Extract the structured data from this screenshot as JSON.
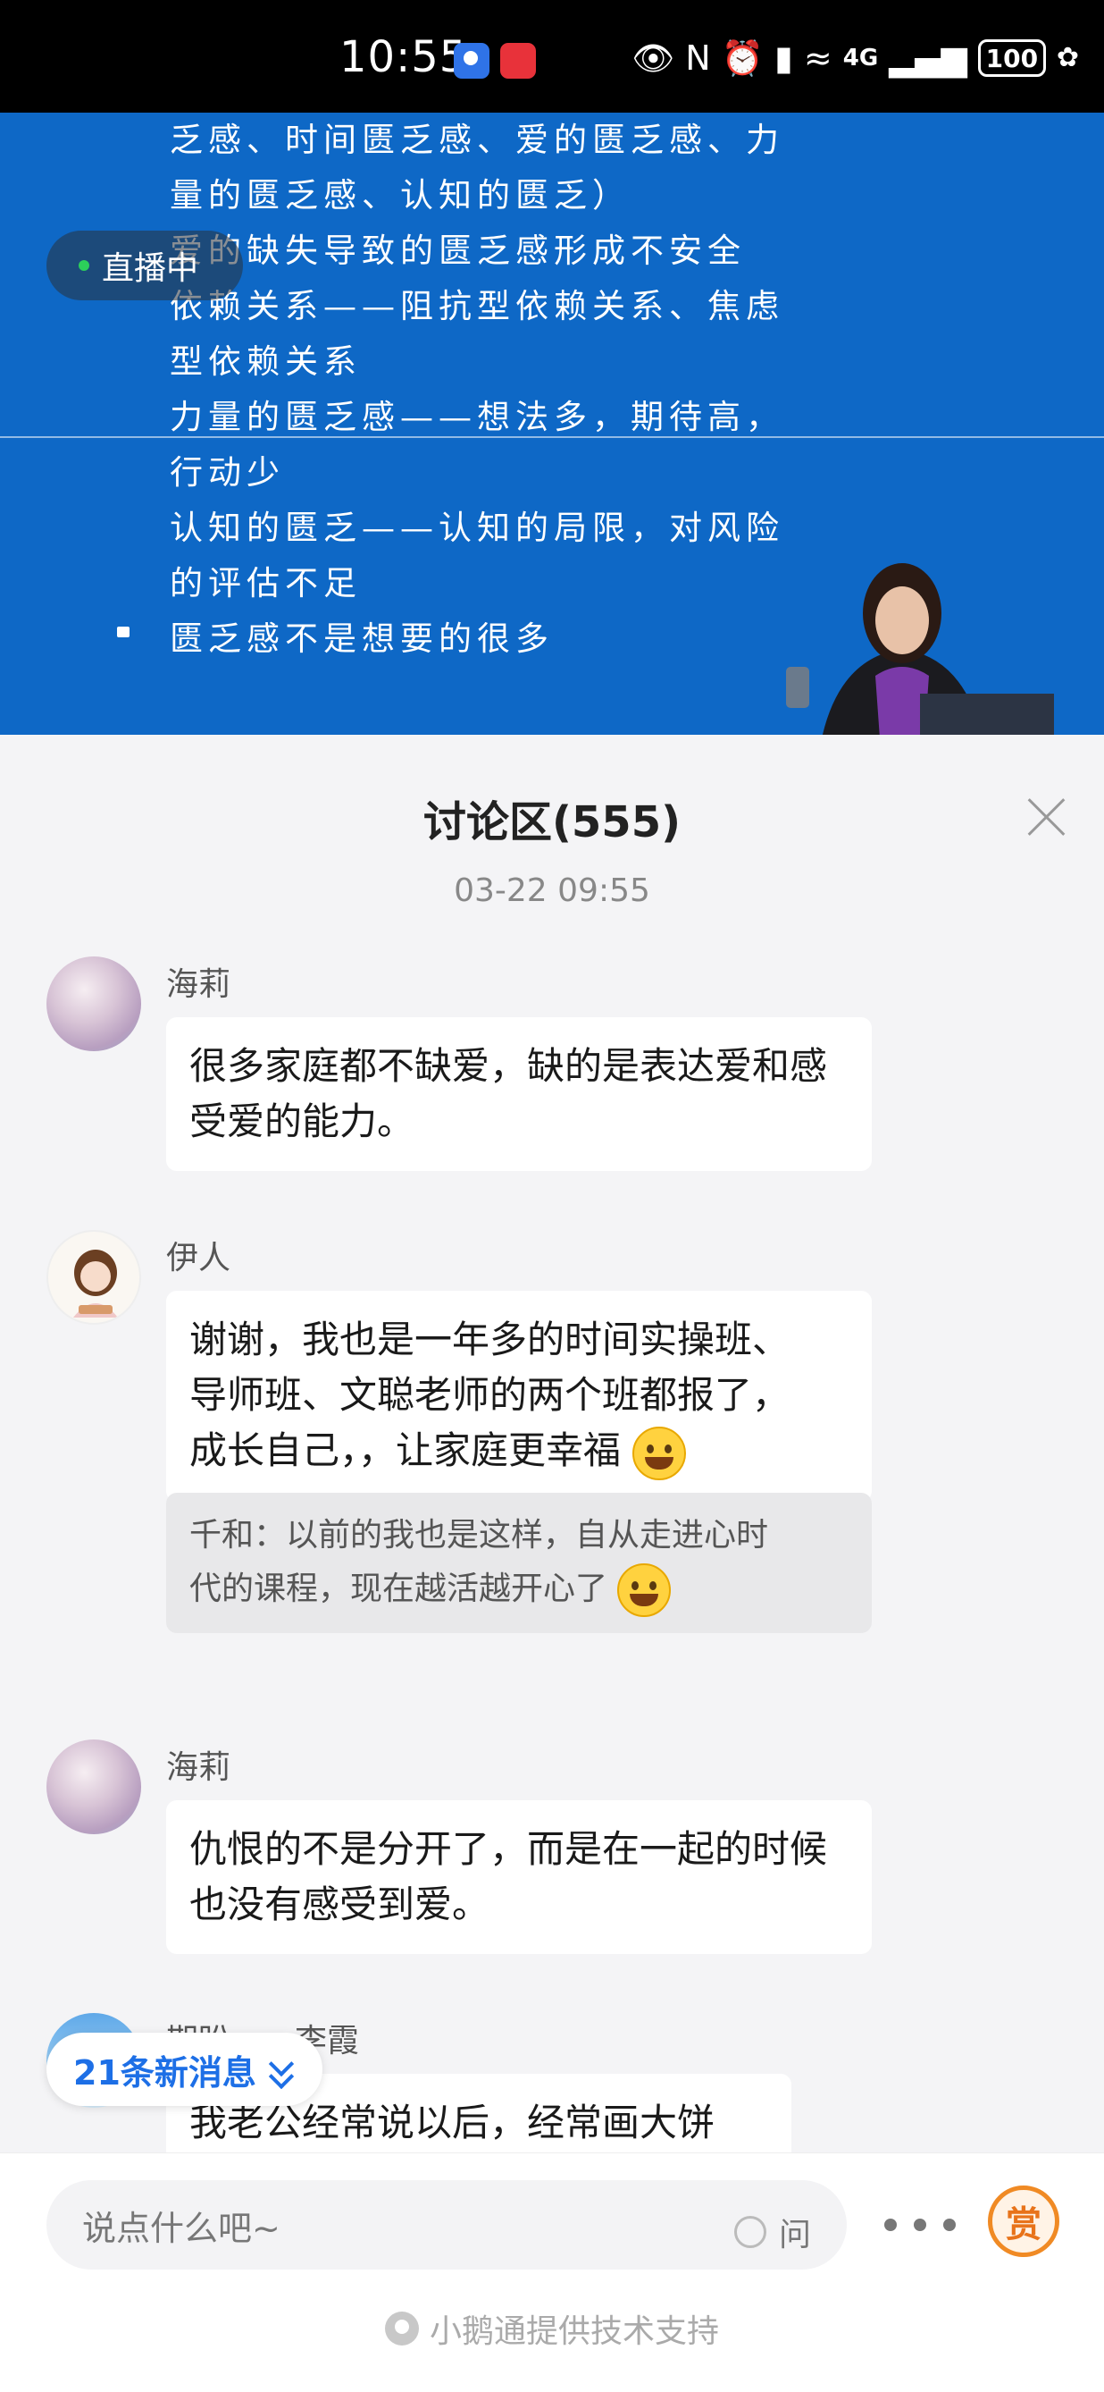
{
  "status_bar": {
    "time": "10:55",
    "battery": "100",
    "network": "4G"
  },
  "video": {
    "live_label": "直播中",
    "slide_lines": [
      "乏感、时间匮乏感、爱的匮乏感、力",
      "量的匮乏感、认知的匮乏）",
      "爱的缺失导致的匮乏感形成不安全",
      "依赖关系——阻抗型依赖关系、焦虑",
      "型依赖关系",
      "力量的匮乏感——想法多，期待高，",
      "行动少",
      "认知的匮乏——认知的局限，对风险",
      "的评估不足",
      "匮乏感不是想要的很多"
    ]
  },
  "discussion": {
    "title": "讨论区(555)",
    "timestamp": "03-22 09:55",
    "messages": [
      {
        "user": "海莉",
        "text": "很多家庭都不缺爱，缺的是表达爱和感受爱的能力。"
      },
      {
        "user": "伊人",
        "text_line1": "谢谢，我也是一年多的时间实操班、",
        "text_line2": "导师班、文聪老师的两个班都报了，",
        "text_line3": "成长自己，，让家庭更幸福",
        "quote_line1": "千和：以前的我也是这样，自从走进心时",
        "quote_line2": "代的课程，现在越活越开心了"
      },
      {
        "user": "海莉",
        "text": "仇恨的不是分开了，而是在一起的时候也没有感受到爱。"
      },
      {
        "user": "期盼……李霞",
        "text": "我老公经常说以后，经常画大饼"
      }
    ],
    "new_messages": "21条新消息"
  },
  "input_bar": {
    "placeholder": "说点什么吧~",
    "ask_label": "问",
    "reward_label": "赏",
    "powered_by": "小鹅通提供技术支持"
  }
}
